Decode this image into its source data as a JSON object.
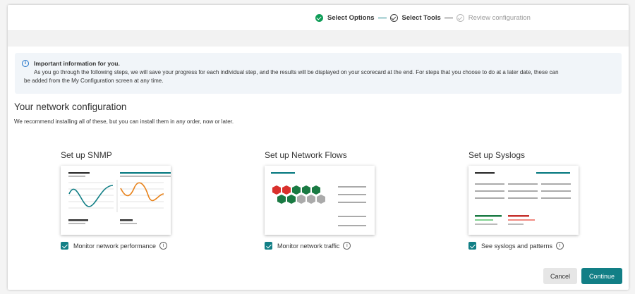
{
  "stepper": {
    "steps": [
      {
        "label": "Select Options",
        "state": "done"
      },
      {
        "label": "Select Tools",
        "state": "current"
      },
      {
        "label": "Review configuration",
        "state": "pending"
      }
    ]
  },
  "info": {
    "title": "Important information for you.",
    "body_line1": "As you go through the following steps, we will save your progress for each individual step, and the results will be displayed on your scorecard at the end. For steps that you choose to do at a later date, these can",
    "body_line2": "be added from the My Configuration screen at any time."
  },
  "section": {
    "title": "Your network configuration",
    "subtitle": "We recommend installing all of these, but you can install them in any order, now or later."
  },
  "cards": [
    {
      "title": "Set up SNMP",
      "checkbox_label": "Monitor network performance",
      "checked": true
    },
    {
      "title": "Set up Network Flows",
      "checkbox_label": "Monitor network traffic",
      "checked": true
    },
    {
      "title": "Set up Syslogs",
      "checkbox_label": "See syslogs and patterns",
      "checked": true
    }
  ],
  "actions": {
    "cancel": "Cancel",
    "continue": "Continue"
  },
  "colors": {
    "accent": "#127f86",
    "success": "#0f9d58",
    "info": "#1b6fc8"
  }
}
